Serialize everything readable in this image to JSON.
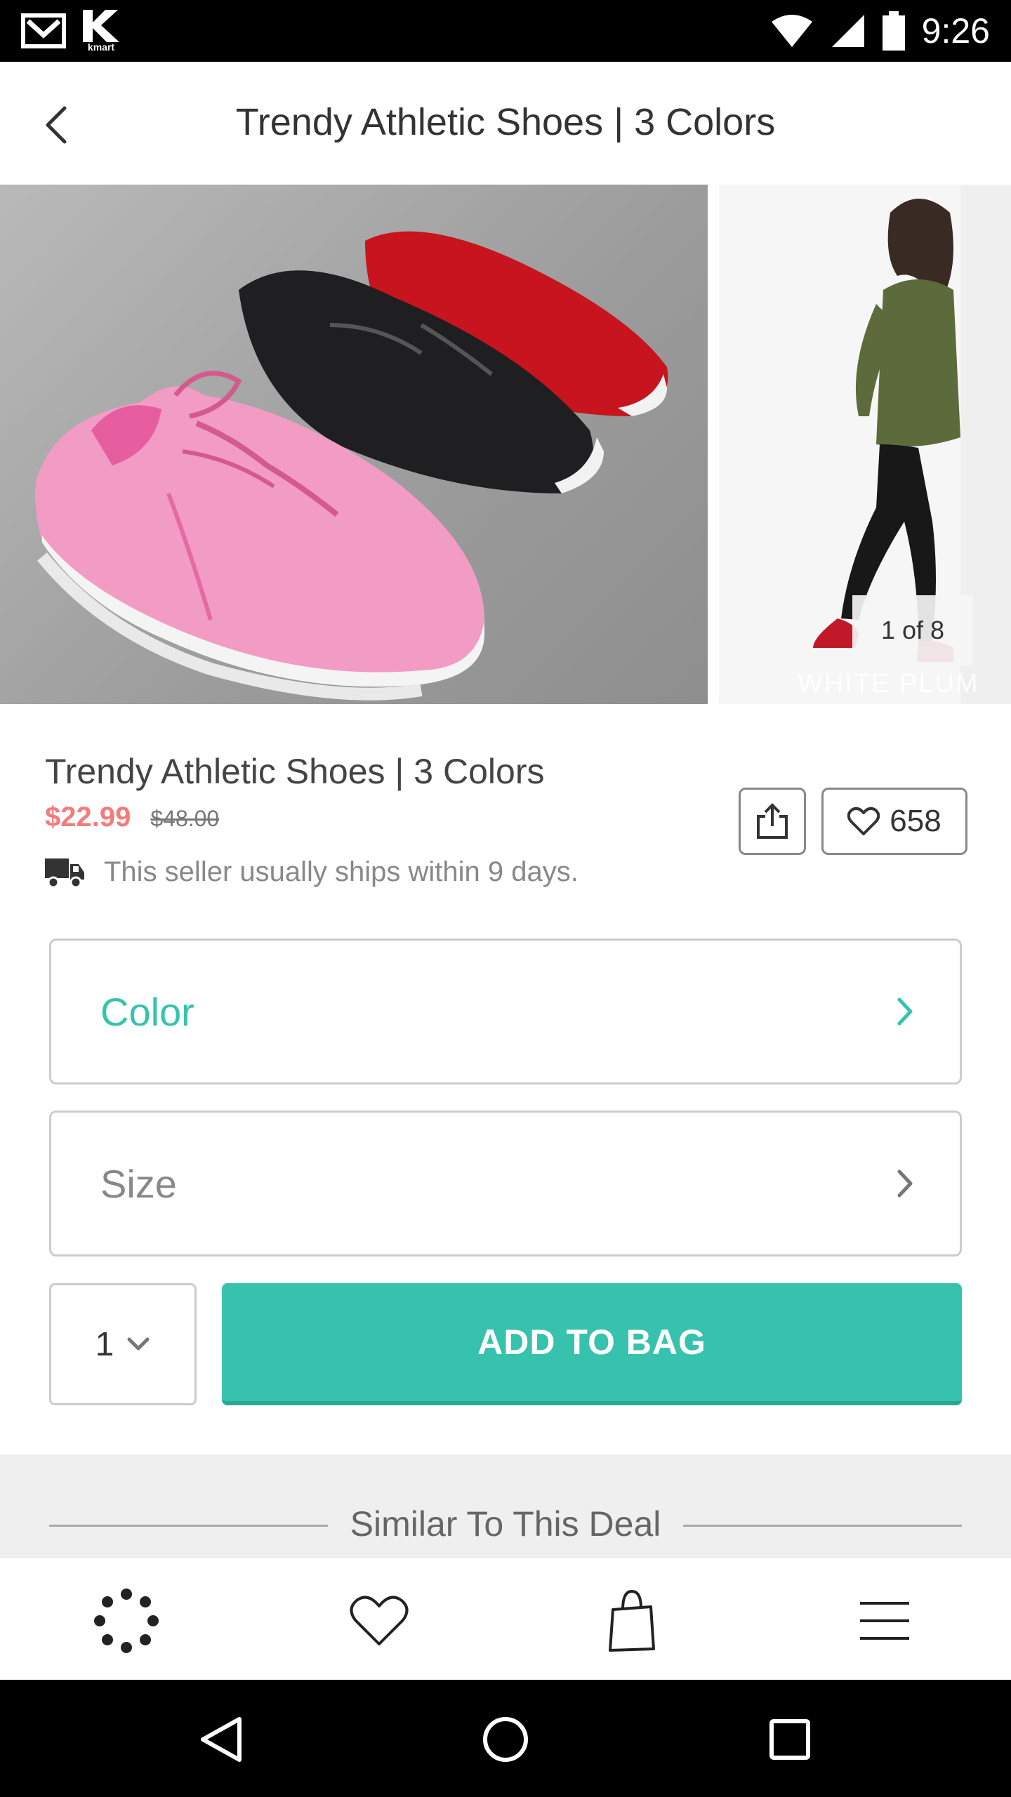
{
  "status_bar": {
    "time": "9:26",
    "icons": [
      "gmail-icon",
      "kmart-icon",
      "wifi-icon",
      "signal-icon",
      "battery-icon"
    ],
    "kmart_label": "kmart"
  },
  "header": {
    "title": "Trendy Athletic Shoes | 3 Colors",
    "back_icon": "chevron-left-icon"
  },
  "gallery": {
    "counter": "1 of 8",
    "watermark": "WHITE PLUM"
  },
  "product": {
    "title": "Trendy Athletic Shoes | 3 Colors",
    "price": "$22.99",
    "original_price": "$48.00",
    "shipping_text": "This seller usually ships within 9 days.",
    "like_count": "658"
  },
  "options": {
    "color_label": "Color",
    "size_label": "Size",
    "quantity": "1",
    "add_to_bag": "ADD TO BAG"
  },
  "similar": {
    "title": "Similar To This Deal"
  },
  "colors": {
    "accent": "#37c2ad",
    "price": "#f47c7c"
  },
  "bottom_nav": [
    "dots-loader-icon",
    "heart-icon",
    "shopping-bag-icon",
    "menu-icon"
  ],
  "android_nav": [
    "back-triangle-icon",
    "home-circle-icon",
    "recents-square-icon"
  ]
}
